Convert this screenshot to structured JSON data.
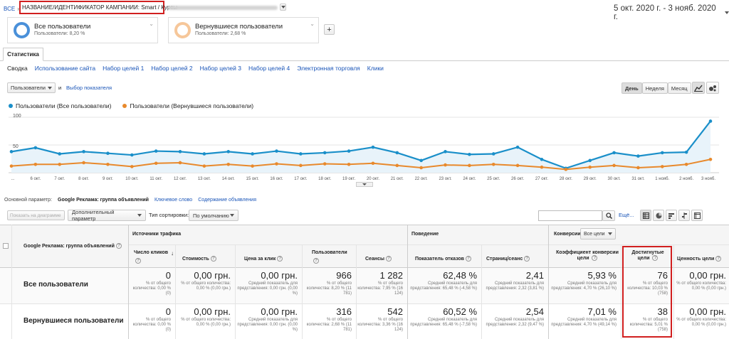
{
  "breadcrumb": {
    "root": "ВСЕ",
    "sep": "»",
    "campaign_label": "НАЗВАНИЕ/ИДЕНТИФИКАТОР КАМПАНИИ: Smart / Курсы"
  },
  "date_range": "5 окт. 2020 г. - 3 нояб. 2020 г.",
  "segments": [
    {
      "name": "Все пользователи",
      "share": "Пользователи: 8,20 %",
      "ring_color": "#4a90d9"
    },
    {
      "name": "Вернувшиеся пользователи",
      "share": "Пользователи: 2,68 %",
      "ring_color": "#f0a050"
    }
  ],
  "add_segment": "+",
  "main_tab": "Статистика",
  "sub_tabs": [
    "Сводка",
    "Использование сайта",
    "Набор целей 1",
    "Набор целей 2",
    "Набор целей 3",
    "Набор целей 4",
    "Электронная торговля",
    "Клики"
  ],
  "metric_select": "Пользователи",
  "and_label": "и",
  "choose_metric": "Выбор показателя",
  "granularity": [
    "День",
    "Неделя",
    "Месяц"
  ],
  "legend": [
    {
      "label": "Пользователи (Все пользователи)",
      "color": "#1a8fc9"
    },
    {
      "label": "Пользователи (Вернувшиеся пользователи)",
      "color": "#e8892c"
    }
  ],
  "chart_data": {
    "type": "line",
    "ylim": [
      0,
      100
    ],
    "yticks": [
      "100",
      "50"
    ],
    "x": [
      "5 окт.",
      "6 окт.",
      "7 окт.",
      "8 окт.",
      "9 окт.",
      "10 окт.",
      "11 окт.",
      "12 окт.",
      "13 окт.",
      "14 окт.",
      "15 окт.",
      "16 окт.",
      "17 окт.",
      "18 окт.",
      "19 окт.",
      "20 окт.",
      "21 окт.",
      "22 окт.",
      "23 окт.",
      "24 окт.",
      "25 окт.",
      "26 окт.",
      "27 окт.",
      "28 окт.",
      "29 окт.",
      "30 окт.",
      "31 окт.",
      "1 нояб.",
      "2 нояб.",
      "3 нояб."
    ],
    "x_labels": [
      "...",
      "6 окт.",
      "7 окт.",
      "8 окт.",
      "9 окт.",
      "10 окт.",
      "11 окт.",
      "12 окт.",
      "13 окт.",
      "14 окт.",
      "15 окт.",
      "16 окт.",
      "17 окт.",
      "18 окт.",
      "19 окт.",
      "20 окт.",
      "21 окт.",
      "22 окт.",
      "23 окт.",
      "24 окт.",
      "25 окт.",
      "26 окт.",
      "27 окт.",
      "28 окт.",
      "29 окт.",
      "30 окт.",
      "31 окт.",
      "1 нояб.",
      "2 нояб.",
      "3 нояб."
    ],
    "series": [
      {
        "name": "Пользователи (Все пользователи)",
        "values": [
          38,
          45,
          34,
          38,
          35,
          32,
          39,
          38,
          34,
          38,
          34,
          39,
          34,
          36,
          39,
          46,
          36,
          22,
          38,
          33,
          34,
          46,
          24,
          8,
          22,
          36,
          30,
          36,
          37,
          93
        ]
      },
      {
        "name": "Пользователи (Вернувшиеся пользователи)",
        "values": [
          12,
          15,
          15,
          18,
          15,
          11,
          17,
          18,
          12,
          15,
          12,
          16,
          13,
          16,
          15,
          17,
          13,
          9,
          14,
          13,
          15,
          13,
          10,
          6,
          10,
          13,
          9,
          11,
          15,
          24
        ]
      }
    ]
  },
  "params": {
    "label": "Основной параметр:",
    "active": "Google Реклама: группа объявлений",
    "options": [
      "Ключевое слово",
      "Содержание объявления"
    ]
  },
  "toolbar": {
    "show_on_chart": "Показать на диаграмме",
    "extra_param": "Дополнительный параметр",
    "sort_label": "Тип сортировки:",
    "sort_value": "По умолчанию",
    "search_placeholder": "",
    "more": "Ещё..."
  },
  "table": {
    "dim_header": "Google Реклама: группа объявлений",
    "group_traffic": "Источники трафика",
    "group_behavior": "Поведение",
    "group_conversions": "Конверсии",
    "goals_select": "Все цели",
    "columns": [
      "Число кликов",
      "Стоимость",
      "Цена за клик",
      "Пользователи",
      "Сеансы",
      "Показатель отказов",
      "Страниц/сеанс",
      "Коэффициент конверсии цели",
      "Достигнутые цели",
      "Ценность цели"
    ],
    "rows": [
      {
        "label": "Все пользователи",
        "cells": [
          {
            "v": "0",
            "s": "% от общего количества: 0,00 % (0)"
          },
          {
            "v": "0,00 грн.",
            "s": "% от общего количества: 0,00 % (0,00 грн.)"
          },
          {
            "v": "0,00 грн.",
            "s": "Средний показатель для представления: 0,00 грн. (0,00 %)"
          },
          {
            "v": "966",
            "s": "% от общего количества: 8,20 % (11 781)"
          },
          {
            "v": "1 282",
            "s": "% от общего количества: 7,95 % (16 124)"
          },
          {
            "v": "62,48 %",
            "s": "Средний показатель для представления: 65,48 % (-4,58 %)"
          },
          {
            "v": "2,41",
            "s": "Средний показатель для представления: 2,32 (3,81 %)"
          },
          {
            "v": "5,93 %",
            "s": "Средний показатель для представления: 4,70 % (26,10 %)"
          },
          {
            "v": "76",
            "s": "% от общего количества: 10,03 % (758)"
          },
          {
            "v": "0,00 грн.",
            "s": "% от общего количества: 0,00 % (0,00 грн.)"
          }
        ]
      },
      {
        "label": "Вернувшиеся пользователи",
        "cells": [
          {
            "v": "0",
            "s": "% от общего количества: 0,00 % (0)"
          },
          {
            "v": "0,00 грн.",
            "s": "% от общего количества: 0,00 % (0,00 грн.)"
          },
          {
            "v": "0,00 грн.",
            "s": "Средний показатель для представления: 0,00 грн. (0,00 %)"
          },
          {
            "v": "316",
            "s": "% от общего количества: 2,68 % (11 781)"
          },
          {
            "v": "542",
            "s": "% от общего количества: 3,36 % (16 124)"
          },
          {
            "v": "60,52 %",
            "s": "Средний показатель для представления: 65,48 % (-7,58 %)"
          },
          {
            "v": "2,54",
            "s": "Средний показатель для представления: 2,32 (9,47 %)"
          },
          {
            "v": "7,01 %",
            "s": "Средний показатель для представления: 4,70 % (49,14 %)"
          },
          {
            "v": "38",
            "s": "% от общего количества: 5,01 % (758)"
          },
          {
            "v": "0,00 грн.",
            "s": "% от общего количества: 0,00 % (0,00 грн.)"
          }
        ]
      }
    ]
  },
  "colors": {
    "highlight": "#d11f1f",
    "link": "#1a55b8"
  }
}
